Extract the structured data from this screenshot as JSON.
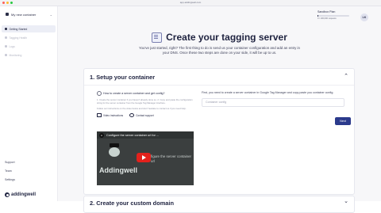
{
  "browser": {
    "url": "app.addingwell.com",
    "dot_colors": [
      "#ff5f57",
      "#febc2e",
      "#28c840"
    ]
  },
  "sidebar": {
    "workspace": "My new container",
    "items": [
      {
        "label": "Getting Started",
        "active": true
      },
      {
        "label": "Tagging Health",
        "active": false
      },
      {
        "label": "Logs",
        "active": false
      },
      {
        "label": "Monitoring",
        "active": false
      }
    ],
    "bottom": [
      "Support",
      "Team",
      "Settings"
    ],
    "logo": "addingwell"
  },
  "header": {
    "plan_title": "Sandbox Plan",
    "plan_usage": "0 / 100,000 requests",
    "plan_usage_fraction": 0.0,
    "avatar_initials": "LK"
  },
  "hero": {
    "title": "Create your tagging server",
    "subtitle": "You've just started, right? The first thing to do is send us your container configuration and add an entry in your DNS. Once these two steps are done on your side, it will be up to us."
  },
  "step1": {
    "title": "1. Setup your container",
    "question": "How to create a server container and get config?",
    "steps": "1. Create the server container if you haven't already done so. 2. Copy and paste the configuration string for the server container from the Google Tag Manager interface.",
    "follow": "Follow our instructions on the video below and don't hesitate to contact us if you need help.",
    "video_link": "Video instructions",
    "support_link": "Contact support",
    "video_title": "Configure the server container url for ...",
    "video_brand": "Addingwell",
    "video_overlay": "figure the server container url",
    "right_text": "First, you need to create a server container in Google Tag Manager and copy paste you container config.",
    "input_placeholder": "Container config",
    "next_label": "Next"
  },
  "step2": {
    "title": "2. Create your custom domain"
  }
}
